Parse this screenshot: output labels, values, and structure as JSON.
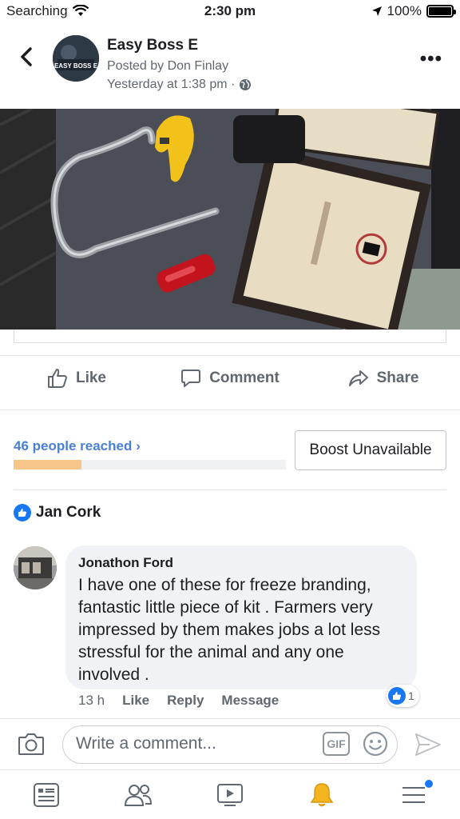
{
  "status_bar": {
    "carrier": "Searching",
    "time": "2:30 pm",
    "battery": "100%"
  },
  "post_header": {
    "page_name": "Easy Boss E",
    "posted_by": "Posted by Don Finlay",
    "timestamp": "Yesterday at 1:38 pm ·",
    "avatar_text": "EASY BOSS E"
  },
  "actions": {
    "like": "Like",
    "comment": "Comment",
    "share": "Share"
  },
  "insights": {
    "reach_label": "46 people reached",
    "reach_fraction": 0.25,
    "boost_label": "Boost Unavailable"
  },
  "reactions": {
    "liked_by": "Jan Cork"
  },
  "comment": {
    "author": "Jonathon Ford",
    "text": "I have one of these for freeze branding, fantastic little piece of kit . Farmers very impressed by them makes jobs a lot less stressful for the animal and any one involved .",
    "time": "13 h",
    "like": "Like",
    "reply": "Reply",
    "message": "Message",
    "reaction_count": "1"
  },
  "composer": {
    "placeholder": "Write a comment...",
    "gif": "GIF"
  },
  "colors": {
    "accent": "#1877f2",
    "link": "#4b7fd3",
    "reach_fill": "#f7c58a"
  }
}
